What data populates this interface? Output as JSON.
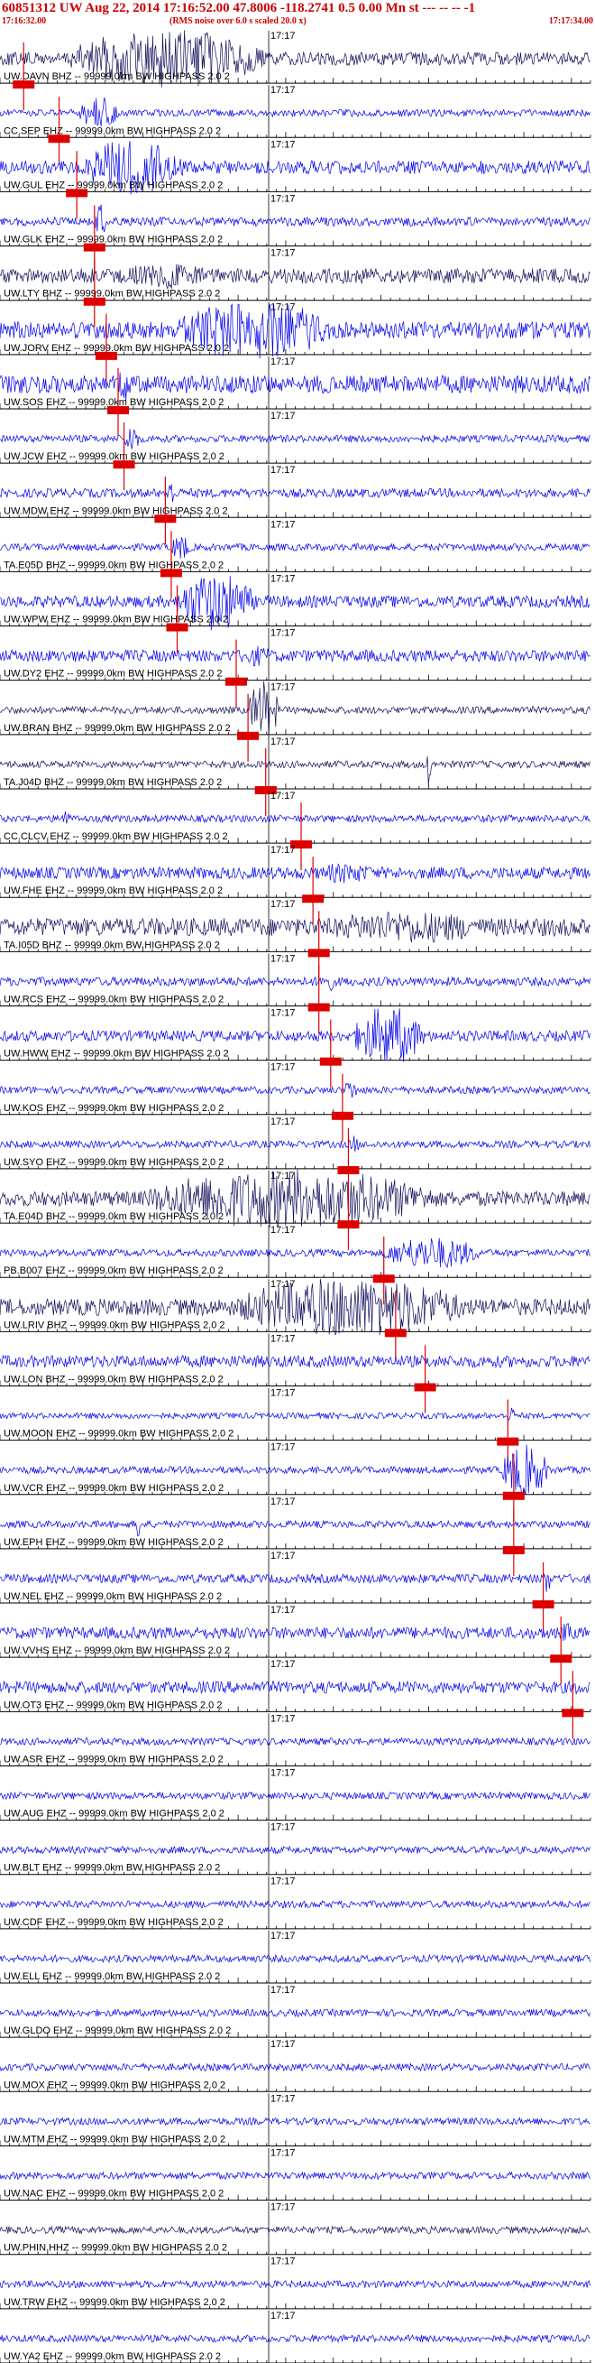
{
  "header": {
    "title": "60851312 UW Aug 22, 2014 17:16:52.00   47.8006 -118.2741  0.5 0.00 Mn st --- -- --  -1",
    "start_time": "17:16:32.00",
    "note": "(RMS noise over 6.0 s scaled 20.0 x)",
    "end_time": "17:17:34.00",
    "colors": {
      "title": "#cc0000",
      "trace": "#0000ee",
      "trace_dark": "#10105a",
      "pick": "#dd0000",
      "axis": "#000000"
    }
  },
  "chart_data": {
    "type": "line",
    "title": "60851312 UW Aug 22, 2014 17:16:52.00   47.8006 -118.2741  0.5 0.00 Mn st --- -- --  -1",
    "xlabel": "",
    "ylabel": "",
    "x_range": [
      "17:16:32.00",
      "17:17:34.00"
    ],
    "x_tick_label": "17:17",
    "channel_suffix": "-- 99999.0km BW  HIGHPASS  2.0  2",
    "grid": false,
    "series": [
      {
        "name": "UW.DAVN BHZ",
        "pick": 0.04,
        "dark": true,
        "burst_start": 0.12,
        "burst_end": 0.62,
        "burst_amp": 1.0,
        "base_amp": 0.22
      },
      {
        "name": "CC.SEP EHZ",
        "pick": 0.1,
        "dark": false,
        "burst_start": 0.13,
        "burst_end": 0.24,
        "burst_amp": 0.55,
        "base_amp": 0.12
      },
      {
        "name": "UW.GUL EHZ",
        "pick": 0.13,
        "dark": false,
        "burst_start": 0.14,
        "burst_end": 0.4,
        "burst_amp": 0.95,
        "base_amp": 0.22
      },
      {
        "name": "UW.GLK EHZ",
        "pick": 0.16,
        "dark": false,
        "burst_start": 0.16,
        "burst_end": 0.19,
        "burst_amp": 0.6,
        "base_amp": 0.15
      },
      {
        "name": "UW.LTY BHZ",
        "pick": 0.16,
        "dark": true,
        "burst_start": 0.2,
        "burst_end": 0.45,
        "burst_amp": 0.45,
        "base_amp": 0.25
      },
      {
        "name": "UW.JORV EHZ",
        "pick": 0.18,
        "dark": false,
        "burst_start": 0.3,
        "burst_end": 0.7,
        "burst_amp": 1.0,
        "base_amp": 0.28
      },
      {
        "name": "UW.SOS EHZ",
        "pick": 0.2,
        "dark": false,
        "burst_start": 0.2,
        "burst_end": 0.24,
        "burst_amp": 0.65,
        "base_amp": 0.3
      },
      {
        "name": "UW.JCW EHZ",
        "pick": 0.21,
        "dark": false,
        "burst_start": 0.21,
        "burst_end": 0.25,
        "burst_amp": 0.5,
        "base_amp": 0.12
      },
      {
        "name": "UW.MDW EHZ",
        "pick": 0.28,
        "dark": false,
        "burst_start": 0.28,
        "burst_end": 0.31,
        "burst_amp": 0.5,
        "base_amp": 0.15
      },
      {
        "name": "TA.E05D BHZ",
        "pick": 0.29,
        "dark": false,
        "burst_start": 0.29,
        "burst_end": 0.34,
        "burst_amp": 0.45,
        "base_amp": 0.12
      },
      {
        "name": "UW.WPW EHZ",
        "pick": 0.3,
        "dark": false,
        "burst_start": 0.3,
        "burst_end": 0.5,
        "burst_amp": 1.0,
        "base_amp": 0.2
      },
      {
        "name": "UW.DY2 EHZ",
        "pick": 0.4,
        "dark": false,
        "burst_start": 0.4,
        "burst_end": 0.5,
        "burst_amp": 0.35,
        "base_amp": 0.2
      },
      {
        "name": "UW.BRAN BHZ",
        "pick": 0.42,
        "dark": true,
        "burst_start": 0.42,
        "burst_end": 0.5,
        "burst_amp": 1.0,
        "base_amp": 0.12
      },
      {
        "name": "TA.J04D BHZ",
        "pick": 0.45,
        "dark": true,
        "burst_start": 0.72,
        "burst_end": 0.735,
        "burst_amp": 0.8,
        "base_amp": 0.12
      },
      {
        "name": "CC.CLCV EHZ",
        "pick": 0.51,
        "dark": false,
        "burst_start": 0.1,
        "burst_end": 0.13,
        "burst_amp": 0.35,
        "base_amp": 0.12
      },
      {
        "name": "UW.FHE EHZ",
        "pick": 0.53,
        "dark": false,
        "burst_start": 0.53,
        "burst_end": 0.7,
        "burst_amp": 0.35,
        "base_amp": 0.2
      },
      {
        "name": "TA.I05D BHZ",
        "pick": 0.54,
        "dark": true,
        "burst_start": 0.54,
        "burst_end": 1.0,
        "burst_amp": 0.55,
        "base_amp": 0.3
      },
      {
        "name": "UW.RCS EHZ",
        "pick": 0.54,
        "dark": false,
        "burst_start": 0.54,
        "burst_end": 0.58,
        "burst_amp": 0.4,
        "base_amp": 0.15
      },
      {
        "name": "UW.HWW EHZ",
        "pick": 0.56,
        "dark": false,
        "burst_start": 0.6,
        "burst_end": 0.78,
        "burst_amp": 1.0,
        "base_amp": 0.18
      },
      {
        "name": "UW.KOS EHZ",
        "pick": 0.58,
        "dark": false,
        "burst_start": 0.58,
        "burst_end": 0.62,
        "burst_amp": 0.35,
        "base_amp": 0.12
      },
      {
        "name": "UW.SYO EHZ",
        "pick": 0.59,
        "dark": false,
        "burst_start": 0.59,
        "burst_end": 0.62,
        "burst_amp": 0.3,
        "base_amp": 0.12
      },
      {
        "name": "TA.E04D BHZ",
        "pick": 0.59,
        "dark": true,
        "burst_start": 0.25,
        "burst_end": 1.0,
        "burst_amp": 1.0,
        "base_amp": 0.25
      },
      {
        "name": "PB.B007 EHZ",
        "pick": 0.65,
        "dark": false,
        "burst_start": 0.65,
        "burst_end": 0.9,
        "burst_amp": 0.55,
        "base_amp": 0.12
      },
      {
        "name": "UW.LRIV BHZ",
        "pick": 0.67,
        "dark": true,
        "burst_start": 0.4,
        "burst_end": 1.0,
        "burst_amp": 1.0,
        "base_amp": 0.28
      },
      {
        "name": "UW.LON BHZ",
        "pick": 0.72,
        "dark": false,
        "burst_start": 0.72,
        "burst_end": 0.75,
        "burst_amp": 0.25,
        "base_amp": 0.2
      },
      {
        "name": "UW.MOON EHZ",
        "pick": 0.86,
        "dark": false,
        "burst_start": 0.86,
        "burst_end": 0.88,
        "burst_amp": 0.3,
        "base_amp": 0.1
      },
      {
        "name": "UW.VCR EHZ",
        "pick": 0.87,
        "dark": false,
        "burst_start": 0.85,
        "burst_end": 0.97,
        "burst_amp": 0.9,
        "base_amp": 0.12
      },
      {
        "name": "UW.EPH EHZ",
        "pick": 0.87,
        "dark": false,
        "burst_start": 0.23,
        "burst_end": 0.24,
        "burst_amp": 0.9,
        "base_amp": 0.12
      },
      {
        "name": "UW.NEL EHZ",
        "pick": 0.92,
        "dark": false,
        "burst_start": 0.92,
        "burst_end": 0.94,
        "burst_amp": 0.5,
        "base_amp": 0.15
      },
      {
        "name": "UW.VVHS EHZ",
        "pick": 0.95,
        "dark": false,
        "burst_start": 0.95,
        "burst_end": 0.98,
        "burst_amp": 0.4,
        "base_amp": 0.2
      },
      {
        "name": "UW.OT3 EHZ",
        "pick": 0.97,
        "dark": false,
        "burst_start": 0.97,
        "burst_end": 1.0,
        "burst_amp": 0.3,
        "base_amp": 0.2
      },
      {
        "name": "UW.ASR EHZ",
        "pick": null,
        "dark": false,
        "burst_start": 0,
        "burst_end": 0,
        "burst_amp": 0,
        "base_amp": 0.12
      },
      {
        "name": "UW.AUG EHZ",
        "pick": null,
        "dark": false,
        "burst_start": 0,
        "burst_end": 0,
        "burst_amp": 0,
        "base_amp": 0.12
      },
      {
        "name": "UW.BLT EHZ",
        "pick": null,
        "dark": false,
        "burst_start": 0,
        "burst_end": 0,
        "burst_amp": 0,
        "base_amp": 0.12
      },
      {
        "name": "UW.CDF EHZ",
        "pick": null,
        "dark": false,
        "burst_start": 0,
        "burst_end": 0,
        "burst_amp": 0,
        "base_amp": 0.12
      },
      {
        "name": "UW.ELL EHZ",
        "pick": null,
        "dark": false,
        "burst_start": 0,
        "burst_end": 0,
        "burst_amp": 0,
        "base_amp": 0.12
      },
      {
        "name": "UW.GLDO EHZ",
        "pick": null,
        "dark": false,
        "burst_start": 0,
        "burst_end": 0,
        "burst_amp": 0,
        "base_amp": 0.12
      },
      {
        "name": "UW.MOX EHZ",
        "pick": null,
        "dark": false,
        "burst_start": 0,
        "burst_end": 0,
        "burst_amp": 0,
        "base_amp": 0.12
      },
      {
        "name": "UW.MTM EHZ",
        "pick": null,
        "dark": false,
        "burst_start": 0,
        "burst_end": 0,
        "burst_amp": 0,
        "base_amp": 0.12
      },
      {
        "name": "UW.NAC EHZ",
        "pick": null,
        "dark": false,
        "burst_start": 0,
        "burst_end": 0,
        "burst_amp": 0,
        "base_amp": 0.12
      },
      {
        "name": "UW.PHIN HHZ",
        "pick": null,
        "dark": true,
        "burst_start": 0,
        "burst_end": 0,
        "burst_amp": 0,
        "base_amp": 0.12
      },
      {
        "name": "UW.TRW EHZ",
        "pick": null,
        "dark": false,
        "burst_start": 0,
        "burst_end": 0,
        "burst_amp": 0,
        "base_amp": 0.12
      },
      {
        "name": "UW.YA2 EHZ",
        "pick": null,
        "dark": false,
        "burst_start": 0,
        "burst_end": 0,
        "burst_amp": 0,
        "base_amp": 0.12
      }
    ]
  }
}
